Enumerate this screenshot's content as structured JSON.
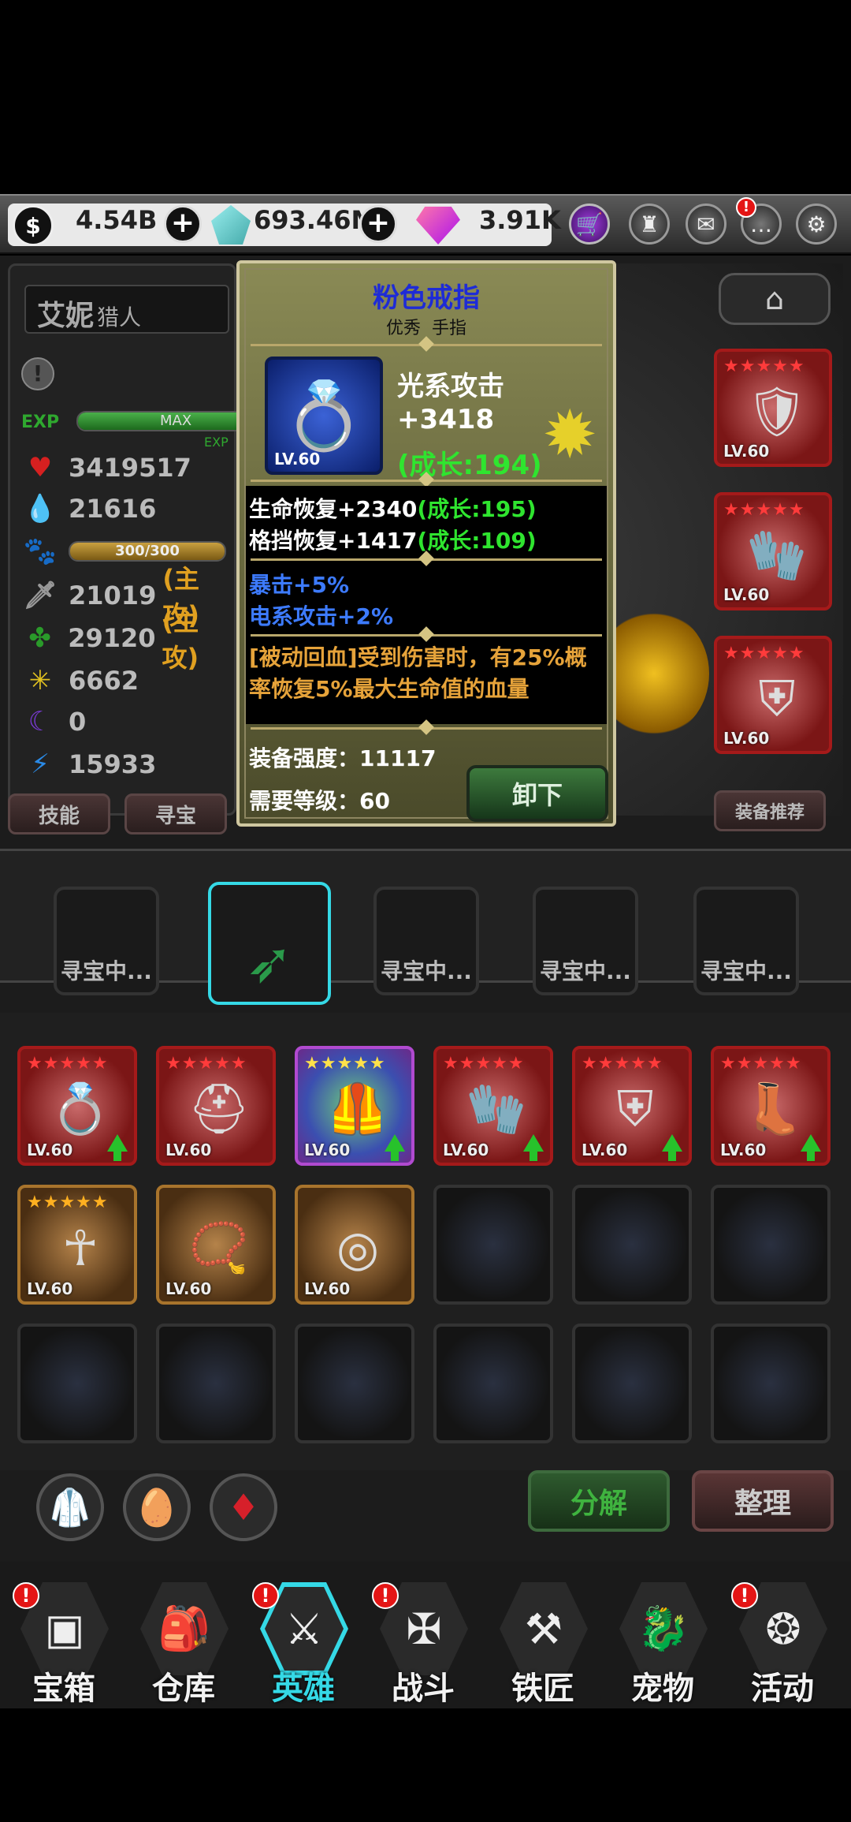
{
  "currencies": {
    "gold": "4.54B",
    "crystal": "693.46M",
    "gem": "3.91K"
  },
  "hero": {
    "name": "艾妮",
    "class": "猎人",
    "exp_label": "EXP",
    "exp_max": "MAX",
    "exp_small": "EXP",
    "pet_bar": "300/300",
    "stats": [
      {
        "icon": "heart-icon",
        "value": "3419517"
      },
      {
        "icon": "drop-icon",
        "value": "21616"
      },
      {
        "icon": "paw-icon",
        "value": ""
      },
      {
        "icon": "sword-icon",
        "value": "21019",
        "tag": "(主攻)"
      },
      {
        "icon": "clover-icon",
        "value": "29120",
        "tag": "(主攻)"
      },
      {
        "icon": "sun-icon",
        "value": "6662"
      },
      {
        "icon": "moon-icon",
        "value": "0"
      },
      {
        "icon": "bolt-icon",
        "value": "15933"
      }
    ],
    "pet_progress": 1.0,
    "exp_progress": 1.0
  },
  "buttons": {
    "skill": "技能",
    "treasure": "寻宝",
    "recommend": "装备推荐",
    "decompose": "分解",
    "arrange": "整理"
  },
  "tooltip": {
    "title": "粉色戒指",
    "subtitle": "优秀  手指",
    "main_stat": "光系攻击",
    "main_value": "+3418",
    "main_growth": "(成长:194)",
    "item_level": "LV.60",
    "sub1": "生命恢复+2340",
    "sub1_growth": "(成长:195)",
    "sub2": "格挡恢复+1417",
    "sub2_growth": "(成长:109)",
    "blue1": "暴击+5%",
    "blue2": "电系攻击+2%",
    "passive": "[被动回血]受到伤害时，有25%概率恢复5%最大生命值的血量",
    "power_label": "装备强度：",
    "power": "11117",
    "req_label": "需要等级：",
    "req": "60",
    "unequip": "卸下"
  },
  "hunt_slots": [
    "寻宝中...",
    "",
    "寻宝中...",
    "寻宝中...",
    "寻宝中..."
  ],
  "side_equipment": [
    {
      "level": "LV.60"
    },
    {
      "level": "LV.60"
    },
    {
      "level": "LV.60"
    }
  ],
  "inventory": [
    {
      "level": "LV.60",
      "icon": "ring-icon"
    },
    {
      "level": "LV.60",
      "icon": "helmet-icon"
    },
    {
      "level": "LV.60",
      "icon": "armor-icon"
    },
    {
      "level": "LV.60",
      "icon": "gloves-icon"
    },
    {
      "level": "LV.60",
      "icon": "shield-icon"
    },
    {
      "level": "LV.60",
      "icon": "boots-icon"
    },
    {
      "level": "LV.60",
      "icon": "amulet-icon"
    },
    {
      "level": "LV.60",
      "icon": "necklace-icon"
    },
    {
      "level": "LV.60",
      "icon": "round-shield-icon"
    }
  ],
  "nav": [
    "宝箱",
    "仓库",
    "英雄",
    "战斗",
    "铁匠",
    "宠物",
    "活动"
  ],
  "colors": {
    "growth": "#2fe52f",
    "blue_stat": "#3d7bff",
    "passive": "#e6a33a",
    "accent_cyan": "#35d9e6"
  }
}
